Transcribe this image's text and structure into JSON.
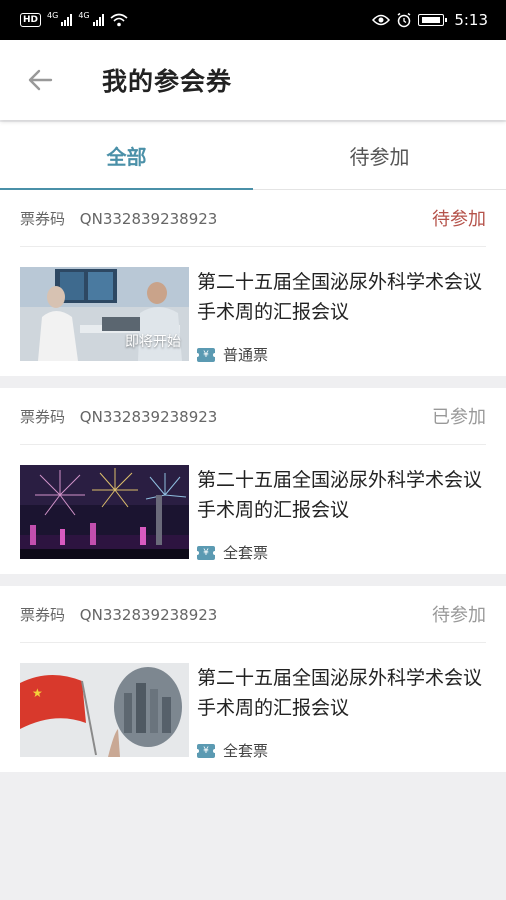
{
  "status_bar": {
    "hd": "HD",
    "net1": "4G",
    "net2": "4G",
    "time": "5:13"
  },
  "header": {
    "title": "我的参会券"
  },
  "tabs": [
    {
      "label": "全部",
      "active": true
    },
    {
      "label": "待参加",
      "active": false
    }
  ],
  "cards": [
    {
      "code_label": "票券码",
      "code": "QN332839238923",
      "status": "待参加",
      "status_color": "#b5524a",
      "title": "第二十五届全国泌尿外科学术会议手术周的汇报会议",
      "thumb_badge": "即将开始",
      "ticket_type": "普通票"
    },
    {
      "code_label": "票券码",
      "code": "QN332839238923",
      "status": "已参加",
      "status_color": "#999999",
      "title": "第二十五届全国泌尿外科学术会议手术周的汇报会议",
      "ticket_type": "全套票"
    },
    {
      "code_label": "票券码",
      "code": "QN332839238923",
      "status": "待参加",
      "status_color": "#999999",
      "title": "第二十五届全国泌尿外科学术会议手术周的汇报会议",
      "ticket_type": "全套票"
    }
  ],
  "ticket_icon_glyph": "¥",
  "colors": {
    "accent": "#4a90a8",
    "pending": "#b5524a",
    "muted": "#999999",
    "ticket_icon": "#5b9ab2"
  }
}
